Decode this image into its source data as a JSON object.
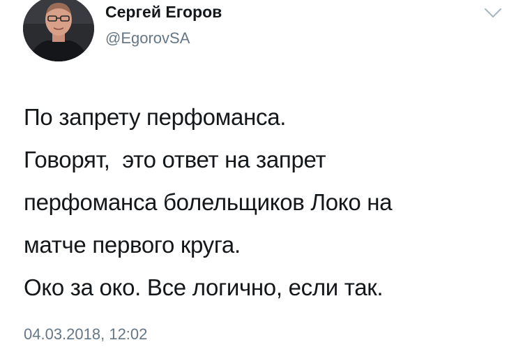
{
  "author": {
    "display_name": "Сергей Егоров",
    "handle": "@EgorovSA",
    "avatar_icon": "profile-photo"
  },
  "tweet": {
    "lines": [
      "По запрету перфоманса.",
      "Говорят,  это ответ на запрет",
      "перфоманса болельщиков Локо на",
      "матче первого круга.",
      "Око за око. Все логично, если так."
    ],
    "timestamp": "04.03.2018, 12:02"
  },
  "menu": {
    "icon": "chevron-down-icon"
  },
  "colors": {
    "primary_text": "#14171a",
    "secondary_text": "#657786",
    "chevron": "#aab8c2"
  }
}
